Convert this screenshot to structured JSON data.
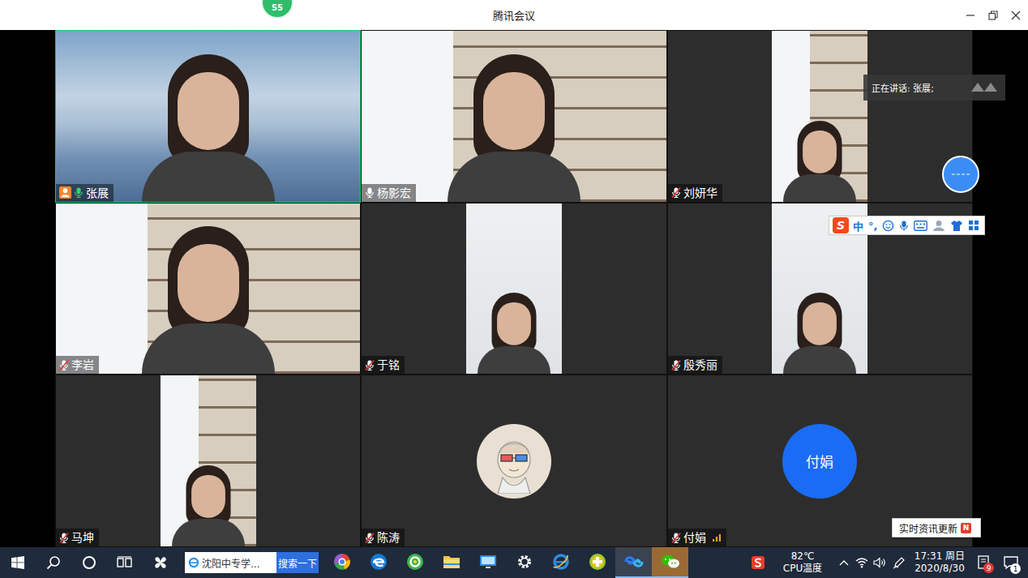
{
  "window": {
    "title": "腾讯会议",
    "badge": "55"
  },
  "participants": [
    {
      "name": "张展",
      "kind": "video-sky",
      "host": true,
      "muted": false,
      "speaking": true,
      "signal": false
    },
    {
      "name": "杨影宏",
      "kind": "video-room",
      "host": false,
      "muted": false,
      "speaking": false,
      "signal": false
    },
    {
      "name": "刘妍华",
      "kind": "video-portrait-room",
      "host": false,
      "muted": true,
      "speaking": false,
      "signal": false
    },
    {
      "name": "李岩",
      "kind": "video-room",
      "host": false,
      "muted": true,
      "speaking": false,
      "signal": false
    },
    {
      "name": "于铭",
      "kind": "video-portrait-plain",
      "host": false,
      "muted": true,
      "speaking": false,
      "signal": false
    },
    {
      "name": "殷秀丽",
      "kind": "video-portrait-plain",
      "host": false,
      "muted": true,
      "speaking": false,
      "signal": false
    },
    {
      "name": "马坤",
      "kind": "video-portrait-room",
      "host": false,
      "muted": true,
      "speaking": false,
      "signal": false
    },
    {
      "name": "陈涛",
      "kind": "avatar",
      "host": false,
      "muted": true,
      "speaking": false,
      "signal": false
    },
    {
      "name": "付娟",
      "kind": "initials",
      "initials": "付娟",
      "host": false,
      "muted": true,
      "speaking": false,
      "signal": true
    }
  ],
  "speaker_notice": "正在讲话: 张展;",
  "ime": {
    "logo": "S",
    "mode": "中",
    "punctuation": "°,"
  },
  "news_popup": {
    "text": "实时资讯更新",
    "badge": "N"
  },
  "taskbar": {
    "left_icons": [
      {
        "kind": "start"
      },
      {
        "kind": "search"
      },
      {
        "kind": "cortana"
      },
      {
        "kind": "taskview"
      },
      {
        "kind": "pinwheel"
      }
    ],
    "search_text": "沈阳中专学...",
    "search_button": "搜索一下",
    "apps": [
      {
        "kind": "browser",
        "active": false,
        "flashing": false
      },
      {
        "kind": "edge",
        "active": false,
        "flashing": false
      },
      {
        "kind": "security",
        "active": false,
        "flashing": false
      },
      {
        "kind": "folder",
        "active": false,
        "flashing": false
      },
      {
        "kind": "monitor",
        "active": false,
        "flashing": false
      },
      {
        "kind": "settings",
        "active": false,
        "flashing": false
      },
      {
        "kind": "ie",
        "active": false,
        "flashing": false
      },
      {
        "kind": "plus",
        "active": false,
        "flashing": false
      },
      {
        "kind": "meeting",
        "active": true,
        "flashing": false
      },
      {
        "kind": "wechat",
        "active": true,
        "flashing": true
      }
    ],
    "temperature": "82℃",
    "temperature_label": "CPU温度",
    "time": "17:31 周日",
    "date": "2020/8/30",
    "notification_count": "9",
    "action_center_count": "1"
  }
}
